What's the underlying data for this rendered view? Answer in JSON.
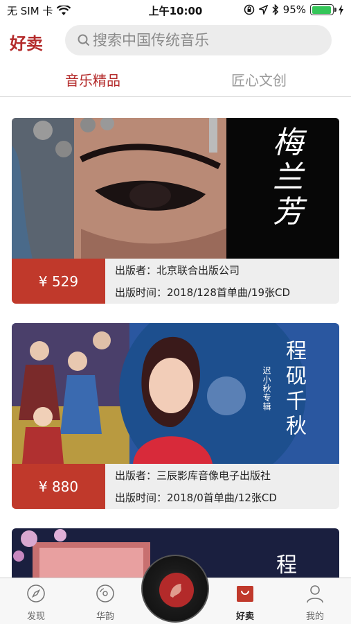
{
  "status_bar": {
    "carrier": "无 SIM 卡",
    "time": "上午10:00",
    "battery": "95%",
    "battery_level": 0.95
  },
  "header": {
    "title": "好卖",
    "search_placeholder": "搜索中国传统音乐"
  },
  "tabs": [
    {
      "label": "音乐精品",
      "active": true
    },
    {
      "label": "匠心文创",
      "active": false
    }
  ],
  "products": [
    {
      "price": "¥ 529",
      "publisher_label": "出版者：",
      "publisher": "北京联合出版公司",
      "date_label": "出版时间：",
      "date_info": "2018/128首单曲/19张CD",
      "cover_title": "梅兰芳"
    },
    {
      "price": "¥ 880",
      "publisher_label": "出版者：",
      "publisher": "三辰影库音像电子出版社",
      "date_label": "出版时间：",
      "date_info": "2018/0首单曲/12张CD",
      "cover_title": "程砚千秋",
      "cover_subtitle": "迟小秋专辑"
    },
    {
      "cover_title": "程"
    }
  ],
  "tabbar": {
    "items": [
      {
        "label": "发现",
        "icon": "compass-icon"
      },
      {
        "label": "华韵",
        "icon": "disc-icon"
      },
      {
        "label": "好卖",
        "icon": "shopping-bag-icon",
        "active": true
      },
      {
        "label": "我的",
        "icon": "person-icon"
      }
    ]
  },
  "colors": {
    "accent": "#b42b2b",
    "price_bg": "#c0392b"
  }
}
